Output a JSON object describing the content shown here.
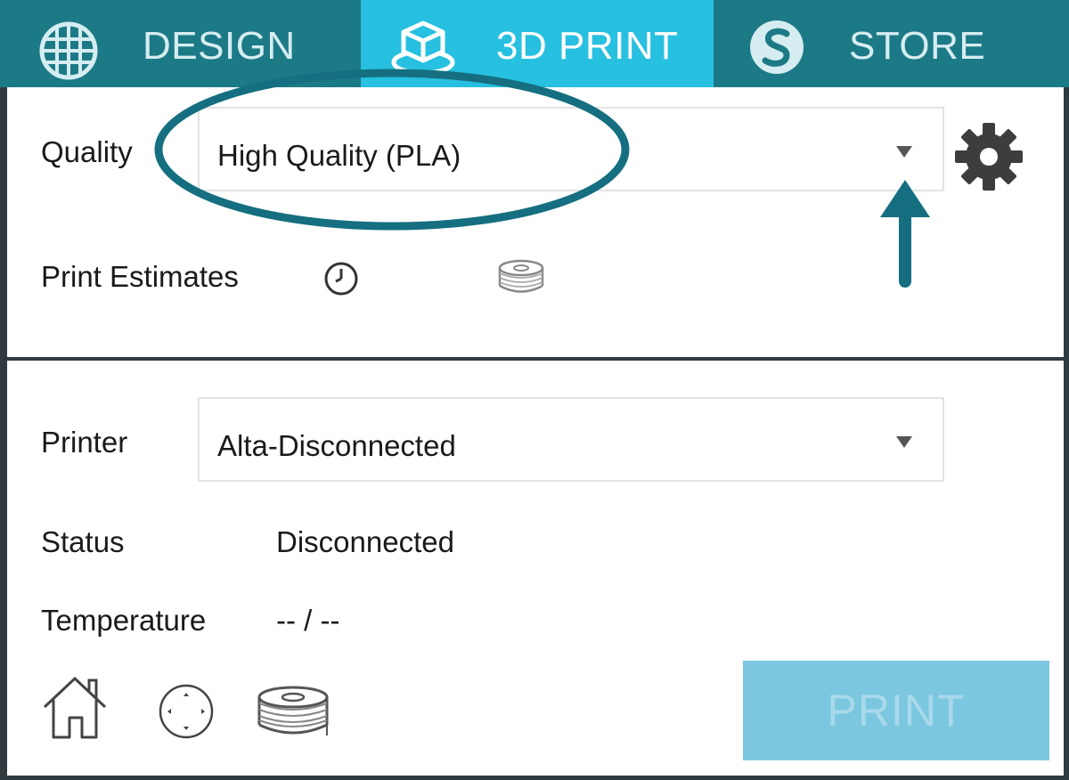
{
  "tabs": [
    {
      "label": "DESIGN",
      "icon": "globe-icon",
      "active": false
    },
    {
      "label": "3D PRINT",
      "icon": "cube-icon",
      "active": true
    },
    {
      "label": "STORE",
      "icon": "silhouette-s-icon",
      "active": false
    }
  ],
  "quality": {
    "label": "Quality",
    "value": "High Quality (PLA)",
    "settings_icon": "gear-icon"
  },
  "estimates": {
    "label": "Print Estimates",
    "time_icon": "clock-icon",
    "material_icon": "filament-spool-icon"
  },
  "printer": {
    "label": "Printer",
    "value": "Alta-Disconnected"
  },
  "status": {
    "label": "Status",
    "value": "Disconnected"
  },
  "temperature": {
    "label": "Temperature",
    "value": "-- / --"
  },
  "controls": {
    "home_icon": "home-icon",
    "move_icon": "move-arrows-icon",
    "filament_icon": "filament-spool-icon"
  },
  "print_button": {
    "label": "PRINT"
  },
  "colors": {
    "tab_bg": "#1c7a86",
    "tab_active": "#27c0e0",
    "annotation": "#156f80",
    "print_button": "#7cc7e0"
  }
}
